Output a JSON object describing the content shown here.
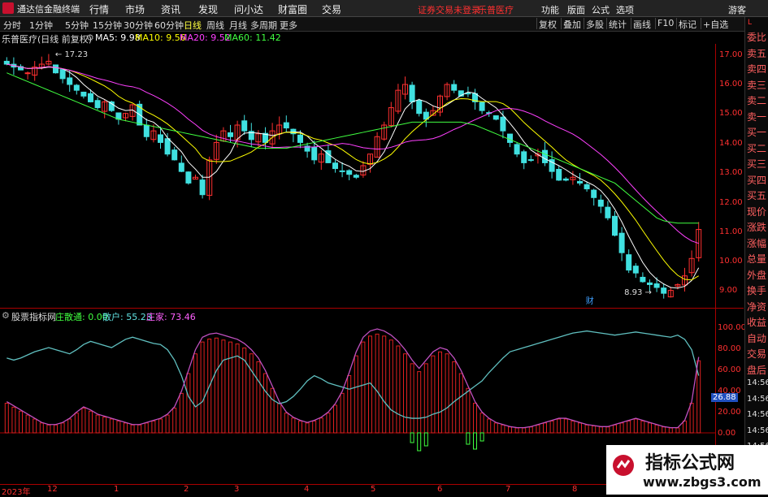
{
  "app": {
    "name": "通达信金融终端",
    "alert": "证券交易未登录",
    "stock_name": "乐普医疗",
    "guest": "游客"
  },
  "menus": [
    "行情",
    "市场",
    "资讯",
    "发现",
    "问小达",
    "财富圈",
    "交易"
  ],
  "top_right_menus": [
    "功能",
    "版面",
    "公式",
    "选项"
  ],
  "timeframes": [
    "分时",
    "1分钟",
    "5分钟",
    "15分钟",
    "30分钟",
    "60分钟",
    "日线",
    "周线",
    "月线",
    "多周期",
    "更多"
  ],
  "active_timeframe": "日线",
  "tool_buttons": [
    "复权",
    "叠加",
    "多股",
    "统计",
    "画线",
    "F10",
    "标记",
    "+自选"
  ],
  "chart_title": "乐普医疗(日线 前复权)",
  "ma": [
    {
      "label": "MA5: 9.98",
      "color": "#ffffff"
    },
    {
      "label": "MA10: 9.56",
      "color": "#ffff00"
    },
    {
      "label": "MA20: 9.52",
      "color": "#ff40ff"
    },
    {
      "label": "MA60: 11.42",
      "color": "#40ff40"
    }
  ],
  "annotations": {
    "high": "17.23",
    "low": "8.93",
    "cai": "财"
  },
  "indicator": {
    "name": "股票指标网",
    "items": [
      {
        "label": "庄散通: 0.00",
        "color": "#40ff40"
      },
      {
        "label": "散户: 55.23",
        "color": "#60e0e0"
      },
      {
        "label": "庄家: 73.46",
        "color": "#ff60ff"
      }
    ],
    "current": "26.88"
  },
  "price_ticks": [
    "17.00",
    "16.00",
    "15.00",
    "14.00",
    "13.00",
    "12.00",
    "11.00",
    "10.00",
    "9.00"
  ],
  "ind_ticks": [
    "100.00",
    "80.00",
    "60.00",
    "40.00",
    "20.00",
    "0.00"
  ],
  "x_labels": [
    "2023年",
    "12",
    "1",
    "2",
    "3",
    "4",
    "5",
    "6",
    "7",
    "8"
  ],
  "right_panel": [
    "委比",
    "卖五",
    "卖四",
    "卖三",
    "卖二",
    "卖一",
    "买一",
    "买二",
    "买三",
    "买四",
    "买五",
    "现价",
    "涨跌",
    "涨幅",
    "总量",
    "外盘",
    "换手",
    "净资",
    "收益",
    "自动",
    "交易",
    "盘后",
    "14:56",
    "14:56",
    "14:56",
    "14:56",
    "14:56",
    "14:56"
  ],
  "watermark": {
    "title": "指标公式网",
    "url": "www.zbgs3.com"
  },
  "chart_data": {
    "type": "candlestick",
    "price_ylim": [
      8.5,
      17.6
    ],
    "close": [
      16.9,
      16.8,
      16.7,
      16.6,
      16.8,
      16.9,
      17.0,
      16.6,
      16.4,
      16.2,
      16.0,
      15.8,
      15.6,
      15.4,
      15.6,
      15.3,
      15.0,
      15.2,
      15.5,
      14.8,
      14.4,
      14.6,
      14.2,
      13.8,
      13.6,
      13.2,
      12.8,
      13.0,
      12.4,
      13.6,
      14.2,
      14.6,
      14.4,
      14.8,
      14.6,
      14.3,
      14.5,
      14.2,
      14.6,
      14.8,
      14.7,
      14.5,
      14.2,
      13.9,
      13.6,
      13.8,
      13.5,
      13.3,
      13.2,
      13.1,
      13.0,
      13.4,
      13.8,
      14.4,
      14.8,
      15.4,
      16.0,
      16.2,
      15.6,
      15.2,
      15.0,
      15.3,
      15.8,
      16.2,
      16.0,
      15.8,
      15.9,
      15.6,
      15.3,
      15.2,
      15.0,
      14.6,
      14.2,
      13.8,
      13.5,
      13.6,
      13.8,
      13.5,
      13.2,
      12.9,
      12.9,
      13.0,
      12.8,
      12.6,
      12.3,
      12.0,
      11.6,
      11.0,
      10.4,
      9.8,
      9.7,
      9.4,
      9.3,
      9.2,
      9.0,
      9.1,
      9.3,
      9.6,
      10.2,
      11.2
    ],
    "ma60": [
      16.6,
      16.5,
      16.4,
      16.3,
      16.2,
      16.1,
      16.0,
      15.9,
      15.8,
      15.7,
      15.6,
      15.5,
      15.4,
      15.3,
      15.2,
      15.1,
      15.0,
      14.95,
      14.9,
      14.85,
      14.8,
      14.75,
      14.7,
      14.65,
      14.6,
      14.55,
      14.5,
      14.45,
      14.4,
      14.35,
      14.3,
      14.25,
      14.2,
      14.15,
      14.1,
      14.05,
      14.0,
      14.0,
      14.0,
      14.0,
      14.0,
      14.05,
      14.1,
      14.15,
      14.2,
      14.25,
      14.3,
      14.35,
      14.4,
      14.45,
      14.5,
      14.55,
      14.6,
      14.65,
      14.7,
      14.75,
      14.8,
      14.85,
      14.9,
      14.9,
      14.9,
      14.9,
      14.9,
      14.9,
      14.9,
      14.9,
      14.85,
      14.8,
      14.7,
      14.6,
      14.5,
      14.4,
      14.3,
      14.2,
      14.1,
      14.0,
      13.9,
      13.8,
      13.7,
      13.6,
      13.5,
      13.4,
      13.3,
      13.2,
      13.1,
      13.0,
      12.9,
      12.8,
      12.6,
      12.4,
      12.2,
      12.0,
      11.8,
      11.6,
      11.5,
      11.45,
      11.42,
      11.42,
      11.42,
      11.42
    ],
    "retail": [
      72,
      70,
      72,
      75,
      78,
      80,
      82,
      80,
      78,
      76,
      80,
      85,
      88,
      86,
      84,
      82,
      86,
      90,
      92,
      90,
      88,
      86,
      85,
      80,
      70,
      55,
      35,
      25,
      30,
      45,
      60,
      70,
      72,
      74,
      70,
      60,
      50,
      40,
      32,
      28,
      30,
      35,
      42,
      50,
      55,
      52,
      48,
      46,
      44,
      42,
      44,
      46,
      48,
      40,
      30,
      22,
      18,
      15,
      14,
      14,
      15,
      18,
      20,
      24,
      30,
      35,
      40,
      45,
      50,
      58,
      65,
      72,
      78,
      80,
      82,
      84,
      86,
      88,
      90,
      92,
      94,
      96,
      97,
      98,
      97,
      96,
      95,
      94,
      95,
      96,
      97,
      96,
      95,
      94,
      93,
      92,
      94,
      90,
      80,
      55
    ],
    "banker": [
      30,
      26,
      22,
      18,
      14,
      10,
      8,
      8,
      10,
      14,
      20,
      25,
      22,
      18,
      16,
      14,
      12,
      10,
      8,
      8,
      10,
      12,
      14,
      18,
      25,
      40,
      60,
      80,
      92,
      95,
      96,
      94,
      92,
      90,
      86,
      80,
      72,
      60,
      45,
      30,
      20,
      15,
      12,
      10,
      12,
      15,
      20,
      28,
      40,
      58,
      78,
      92,
      98,
      100,
      98,
      94,
      88,
      80,
      70,
      62,
      70,
      78,
      82,
      80,
      72,
      60,
      45,
      30,
      20,
      14,
      10,
      8,
      6,
      5,
      5,
      6,
      8,
      10,
      12,
      14,
      14,
      12,
      10,
      8,
      7,
      6,
      6,
      8,
      10,
      12,
      14,
      12,
      10,
      8,
      6,
      5,
      5,
      12,
      30,
      73
    ]
  }
}
